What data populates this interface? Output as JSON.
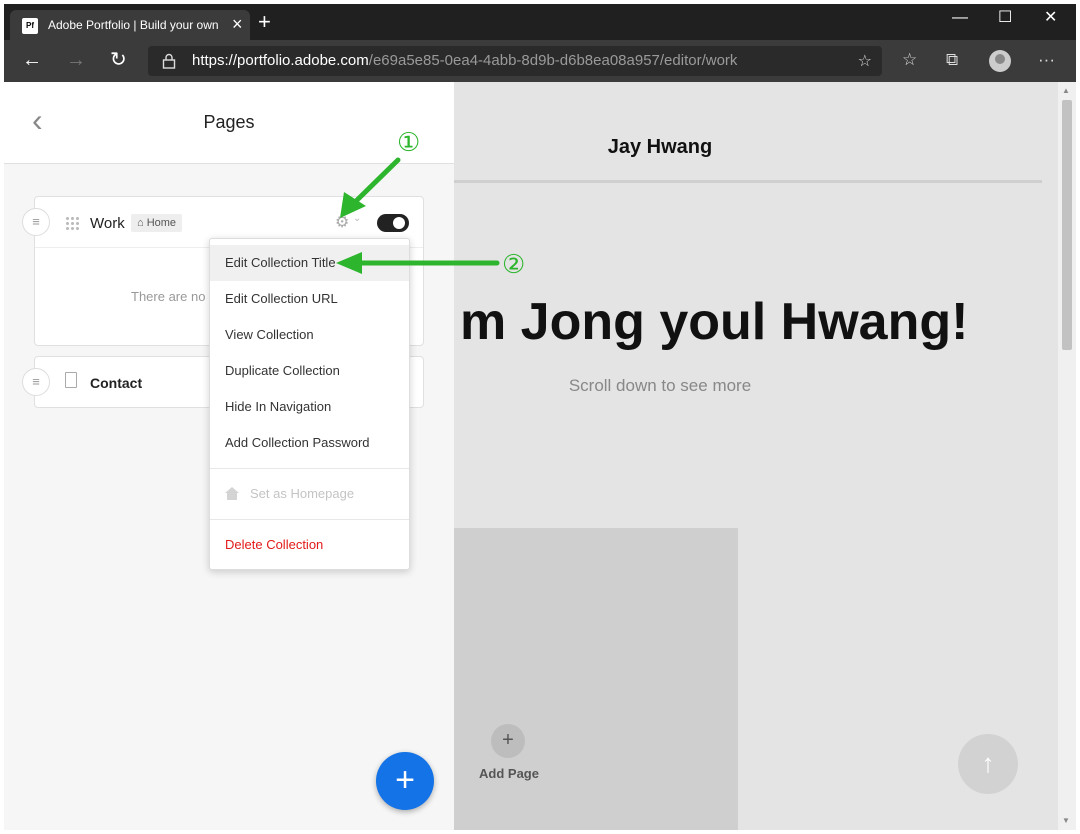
{
  "browser": {
    "tab_title": "Adobe Portfolio | Build your own",
    "tab_favicon": "Pf",
    "url_host": "https://portfolio.adobe.com",
    "url_path": "/e69a5e85-0ea4-4abb-8d9b-d6b8ea08a957/editor/work",
    "icons": [
      "back-arrow-icon",
      "forward-arrow-icon",
      "refresh-icon",
      "lock-icon",
      "favorite-star-icon",
      "favorites-list-icon",
      "collections-icon",
      "profile-icon",
      "more-menu-icon"
    ]
  },
  "panel": {
    "title": "Pages",
    "work_page": {
      "label": "Work",
      "badge": "Home",
      "empty_text": "There are no p"
    },
    "contact_page": {
      "label": "Contact"
    },
    "fab_label": "+"
  },
  "menu": {
    "items": [
      "Edit Collection Title",
      "Edit Collection URL",
      "View Collection",
      "Duplicate Collection",
      "Hide In Navigation",
      "Add Collection Password"
    ],
    "set_homepage": "Set as Homepage",
    "delete": "Delete Collection"
  },
  "preview": {
    "site_title": "Jay Hwang",
    "hero": "m Jong youl Hwang!",
    "hero_sub": "Scroll down to see more",
    "add_page": "Add Page"
  },
  "annotations": {
    "step1": "①",
    "step2": "②",
    "color": "#2db52d"
  },
  "colors": {
    "accent_blue": "#1473e6",
    "danger_red": "#e21a1a"
  }
}
